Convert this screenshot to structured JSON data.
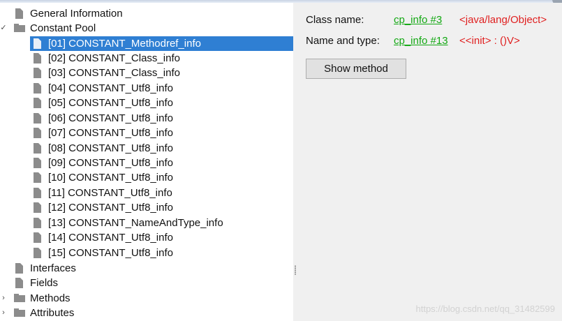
{
  "tree": {
    "items": [
      {
        "label": "General Information",
        "icon": "file-icon"
      },
      {
        "label": "Constant Pool",
        "icon": "folder-icon",
        "chevron": "✓"
      },
      {
        "label": "[01] CONSTANT_Methodref_info",
        "icon": "file-icon",
        "selected": true
      },
      {
        "label": "[02] CONSTANT_Class_info",
        "icon": "file-icon"
      },
      {
        "label": "[03] CONSTANT_Class_info",
        "icon": "file-icon"
      },
      {
        "label": "[04] CONSTANT_Utf8_info",
        "icon": "file-icon"
      },
      {
        "label": "[05] CONSTANT_Utf8_info",
        "icon": "file-icon"
      },
      {
        "label": "[06] CONSTANT_Utf8_info",
        "icon": "file-icon"
      },
      {
        "label": "[07] CONSTANT_Utf8_info",
        "icon": "file-icon"
      },
      {
        "label": "[08] CONSTANT_Utf8_info",
        "icon": "file-icon"
      },
      {
        "label": "[09] CONSTANT_Utf8_info",
        "icon": "file-icon"
      },
      {
        "label": "[10] CONSTANT_Utf8_info",
        "icon": "file-icon"
      },
      {
        "label": "[11] CONSTANT_Utf8_info",
        "icon": "file-icon"
      },
      {
        "label": "[12] CONSTANT_Utf8_info",
        "icon": "file-icon"
      },
      {
        "label": "[13] CONSTANT_NameAndType_info",
        "icon": "file-icon"
      },
      {
        "label": "[14] CONSTANT_Utf8_info",
        "icon": "file-icon"
      },
      {
        "label": "[15] CONSTANT_Utf8_info",
        "icon": "file-icon"
      },
      {
        "label": "Interfaces",
        "icon": "file-icon"
      },
      {
        "label": "Fields",
        "icon": "file-icon"
      },
      {
        "label": "Methods",
        "icon": "folder-icon",
        "chevron": "›"
      },
      {
        "label": "Attributes",
        "icon": "folder-icon",
        "chevron": "›"
      }
    ]
  },
  "details": {
    "class_name_label": "Class name:",
    "class_name_link": "cp_info #3",
    "class_name_value": "<java/lang/Object>",
    "name_type_label": "Name and type:",
    "name_type_link": "cp_info #13",
    "name_type_value": "<<init> : ()V>",
    "show_method_button": "Show method"
  },
  "watermark": "https://blog.csdn.net/qq_31482599",
  "colors": {
    "selection": "#2f7fd3",
    "link": "#13a813",
    "value": "#e02020"
  }
}
